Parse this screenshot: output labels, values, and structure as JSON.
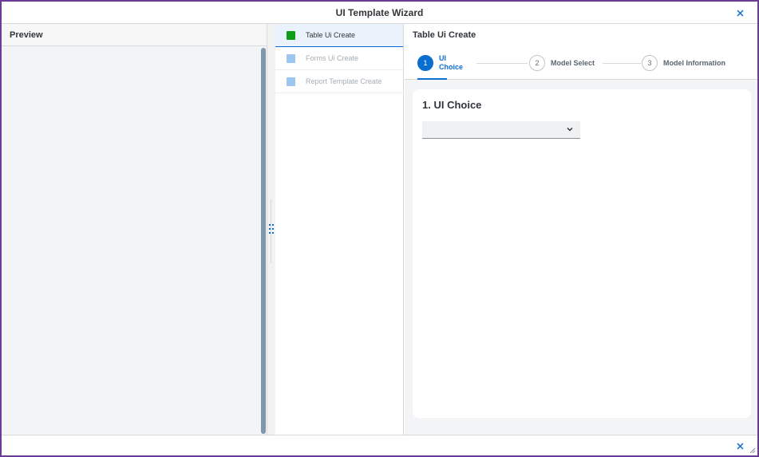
{
  "dialog": {
    "title": "UI Template Wizard"
  },
  "preview": {
    "header": "Preview"
  },
  "steps": [
    {
      "label": "Table Ui Create",
      "color": "#0f9d18",
      "state": "active"
    },
    {
      "label": "Forms Ui Create",
      "color": "#9cc6ef",
      "state": "inactive"
    },
    {
      "label": "Report Template Create",
      "color": "#9cc6ef",
      "state": "inactive"
    }
  ],
  "main": {
    "header": "Table Ui Create",
    "wizard_steps": [
      {
        "number": "1",
        "label_line1": "UI",
        "label_line2": "Choice",
        "state": "current"
      },
      {
        "number": "2",
        "label": "Model Select",
        "state": "pending"
      },
      {
        "number": "3",
        "label": "Model Information",
        "state": "pending"
      }
    ],
    "section_title": "1. UI Choice",
    "select": {
      "value": ""
    }
  },
  "colors": {
    "accent": "#0a6ed1",
    "border": "#6a3c97"
  },
  "icons": [
    "close-icon",
    "chevron-down-icon",
    "splitter-grip-icon",
    "resize-handle-icon"
  ]
}
